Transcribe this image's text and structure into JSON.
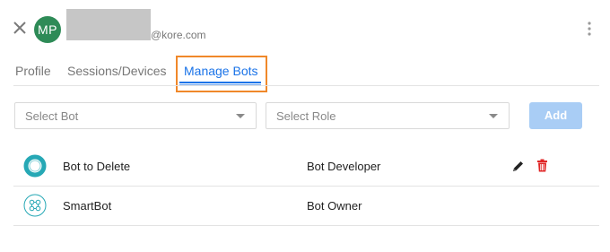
{
  "header": {
    "avatar_initials": "MP",
    "email_suffix": "@kore.com",
    "avatar_color": "#2e8b57"
  },
  "tabs": [
    {
      "label": "Profile",
      "active": false
    },
    {
      "label": "Sessions/Devices",
      "active": false
    },
    {
      "label": "Manage Bots",
      "active": true
    }
  ],
  "form": {
    "select_bot_placeholder": "Select Bot",
    "select_role_placeholder": "Select Role",
    "add_label": "Add"
  },
  "bots": [
    {
      "name": "Bot to Delete",
      "role": "Bot Developer",
      "icon": "ring-bot-icon",
      "actions": [
        "edit-icon",
        "trash-icon"
      ]
    },
    {
      "name": "SmartBot",
      "role": "Bot Owner",
      "icon": "smartbot-icon",
      "actions": []
    }
  ],
  "colors": {
    "accent": "#1a73e8",
    "highlight": "#f0882a",
    "danger": "#e02424",
    "teal": "#26a8b5"
  }
}
